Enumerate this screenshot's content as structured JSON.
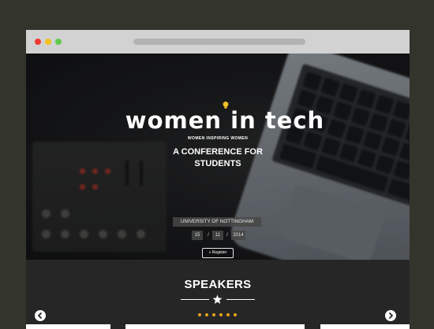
{
  "hero": {
    "logo_text": "women in tech",
    "tagline": "WOMEN INSPIRING WOMEN",
    "headline_line1": "A CONFERENCE FOR",
    "headline_line2": "STUDENTS",
    "venue": "UNIVERSITY OF NOTTINGHAM",
    "date": {
      "day": "15",
      "month": "11",
      "year": "2014",
      "separator": "/"
    },
    "register_label": "» Register"
  },
  "speakers": {
    "title": "SPEAKERS",
    "pager_count": 6
  },
  "colors": {
    "accent": "#e7a21f",
    "bulb": "#f3c22a",
    "titlebar": "#d2d2d2",
    "background": "#33342c"
  },
  "icons": {
    "logo_mark": "lightbulb-icon",
    "divider": "star-icon",
    "prev": "chevron-left-icon",
    "next": "chevron-right-icon"
  }
}
